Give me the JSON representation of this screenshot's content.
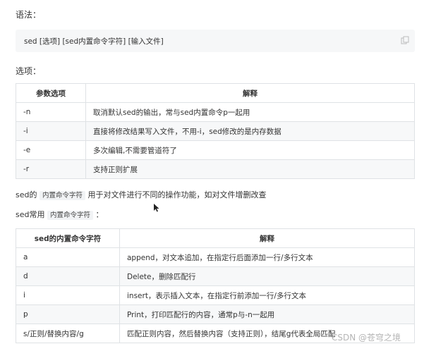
{
  "syntax_label": "语法：",
  "syntax_code": "sed [选项] [sed内置命令字符] [输入文件]",
  "options_label": "选项：",
  "options_table": {
    "headers": [
      "参数选项",
      "解释"
    ],
    "rows": [
      [
        "-n",
        "取消默认sed的输出，常与sed内置命令p一起用"
      ],
      [
        "-i",
        "直接将修改结果写入文件，不用-i，sed修改的是内存数据"
      ],
      [
        "-e",
        "多次编辑,不需要管道符了"
      ],
      [
        "-r",
        "支持正则扩展"
      ]
    ]
  },
  "desc1": {
    "prefix": "sed的",
    "code": "内置命令字符",
    "suffix": "用于对文件进行不同的操作功能，如对文件增删改查"
  },
  "desc2": {
    "prefix": "sed常用",
    "code": "内置命令字符",
    "suffix": "："
  },
  "commands_table": {
    "headers": [
      "sed的内置命令字符",
      "解释"
    ],
    "rows": [
      [
        "a",
        "append，对文本追加，在指定行后面添加一行/多行文本"
      ],
      [
        "d",
        "Delete，删除匹配行"
      ],
      [
        "i",
        "insert，表示插入文本，在指定行前添加一行/多行文本"
      ],
      [
        "p",
        "Print，打印匹配行的内容，通常p与-n一起用"
      ],
      [
        "s/正则/替换内容/g",
        "匹配正则内容，然后替换内容（支持正则），结尾g代表全局匹配"
      ]
    ]
  },
  "watermark": "CSDN @苍穹之境",
  "icons": [
    "copy-icon",
    "cursor-icon"
  ]
}
